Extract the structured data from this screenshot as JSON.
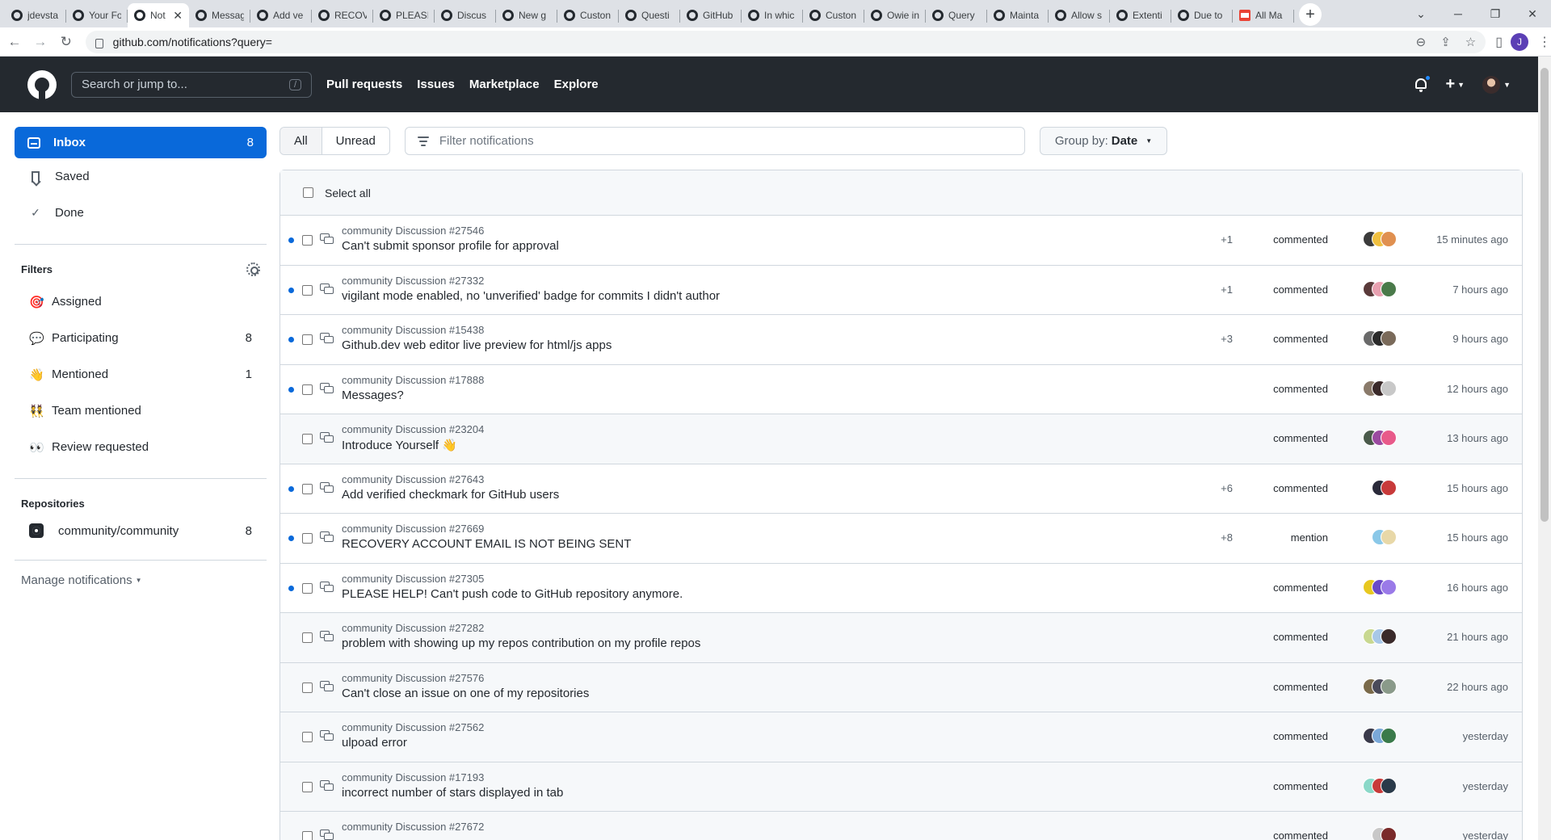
{
  "browser": {
    "tabs": [
      {
        "label": "jdevsta",
        "active": false
      },
      {
        "label": "Your Fo",
        "active": false
      },
      {
        "label": "Not",
        "active": true
      },
      {
        "label": "Messag",
        "active": false
      },
      {
        "label": "Add ve",
        "active": false
      },
      {
        "label": "RECOV",
        "active": false
      },
      {
        "label": "PLEASE",
        "active": false
      },
      {
        "label": "Discus",
        "active": false
      },
      {
        "label": "New g",
        "active": false
      },
      {
        "label": "Custon",
        "active": false
      },
      {
        "label": "Questi",
        "active": false
      },
      {
        "label": "GitHub",
        "active": false
      },
      {
        "label": "In whic",
        "active": false
      },
      {
        "label": "Custon",
        "active": false
      },
      {
        "label": "Owie in",
        "active": false
      },
      {
        "label": "Query",
        "active": false
      },
      {
        "label": "Mainta",
        "active": false
      },
      {
        "label": "Allow s",
        "active": false
      },
      {
        "label": "Extenti",
        "active": false
      },
      {
        "label": "Due to",
        "active": false
      },
      {
        "label": "All Ma",
        "active": false,
        "gmail": true
      }
    ],
    "url": "github.com/notifications?query=",
    "profile_initial": "J"
  },
  "header": {
    "search_placeholder": "Search or jump to...",
    "slash": "/",
    "nav": [
      "Pull requests",
      "Issues",
      "Marketplace",
      "Explore"
    ]
  },
  "sidebar": {
    "inbox": {
      "label": "Inbox",
      "count": "8"
    },
    "saved": "Saved",
    "done": "Done",
    "filters_title": "Filters",
    "filters": [
      {
        "emoji": "🎯",
        "label": "Assigned",
        "count": ""
      },
      {
        "emoji": "💬",
        "label": "Participating",
        "count": "8"
      },
      {
        "emoji": "👋",
        "label": "Mentioned",
        "count": "1"
      },
      {
        "emoji": "👯",
        "label": "Team mentioned",
        "count": ""
      },
      {
        "emoji": "👀",
        "label": "Review requested",
        "count": ""
      }
    ],
    "repos_title": "Repositories",
    "repos": [
      {
        "label": "community/community",
        "count": "8"
      }
    ],
    "manage": "Manage notifications"
  },
  "toolbar": {
    "all": "All",
    "unread": "Unread",
    "filter_placeholder": "Filter notifications",
    "group_by_label": "Group by:",
    "group_by_value": "Date"
  },
  "list": {
    "select_all": "Select all",
    "rows": [
      {
        "meta": "community Discussion #27546",
        "title": "Can't submit sponsor profile for approval",
        "plus": "+1",
        "reason": "commented",
        "time": "15 minutes ago",
        "unread": true,
        "avatars": [
          "#3b3b3b",
          "#f0c040",
          "#e09050"
        ]
      },
      {
        "meta": "community Discussion #27332",
        "title": "vigilant mode enabled, no 'unverified' badge for commits I didn't author",
        "plus": "+1",
        "reason": "commented",
        "time": "7 hours ago",
        "unread": true,
        "avatars": [
          "#5a3a3a",
          "#e8a0b0",
          "#4a7a4a"
        ]
      },
      {
        "meta": "community Discussion #15438",
        "title": "Github.dev web editor live preview for html/js apps",
        "plus": "+3",
        "reason": "commented",
        "time": "9 hours ago",
        "unread": true,
        "avatars": [
          "#6a6a6a",
          "#2a2a2a",
          "#7a6a5a"
        ]
      },
      {
        "meta": "community Discussion #17888",
        "title": "Messages?",
        "plus": "",
        "reason": "commented",
        "time": "12 hours ago",
        "unread": true,
        "avatars": [
          "#8a7a6a",
          "#3a2a2a",
          "#c8c8c8"
        ]
      },
      {
        "meta": "community Discussion #23204",
        "title": "Introduce Yourself 👋",
        "plus": "",
        "reason": "commented",
        "time": "13 hours ago",
        "unread": false,
        "avatars": [
          "#4a5a4a",
          "#9a4aa0",
          "#e85a8a"
        ]
      },
      {
        "meta": "community Discussion #27643",
        "title": "Add verified checkmark for GitHub users",
        "plus": "+6",
        "reason": "commented",
        "time": "15 hours ago",
        "unread": true,
        "avatars": [
          "#2a2a3a",
          "#c83a3a"
        ]
      },
      {
        "meta": "community Discussion #27669",
        "title": "RECOVERY ACCOUNT EMAIL IS NOT BEING SENT",
        "plus": "+8",
        "reason": "mention",
        "time": "15 hours ago",
        "unread": true,
        "avatars": [
          "#8ac8e8",
          "#e8d8a8"
        ]
      },
      {
        "meta": "community Discussion #27305",
        "title": "PLEASE HELP! Can't push code to GitHub repository anymore.",
        "plus": "",
        "reason": "commented",
        "time": "16 hours ago",
        "unread": true,
        "avatars": [
          "#e8c820",
          "#6a4ac8",
          "#9a7ae8"
        ]
      },
      {
        "meta": "community Discussion #27282",
        "title": "problem with showing up my repos contribution on my profile repos",
        "plus": "",
        "reason": "commented",
        "time": "21 hours ago",
        "unread": false,
        "avatars": [
          "#c8d890",
          "#a8c8e8",
          "#3a2a2a"
        ]
      },
      {
        "meta": "community Discussion #27576",
        "title": "Can't close an issue on one of my repositories",
        "plus": "",
        "reason": "commented",
        "time": "22 hours ago",
        "unread": false,
        "avatars": [
          "#7a6a4a",
          "#4a4a5a",
          "#8a9a8a"
        ]
      },
      {
        "meta": "community Discussion #27562",
        "title": "ulpoad error",
        "plus": "",
        "reason": "commented",
        "time": "yesterday",
        "unread": false,
        "avatars": [
          "#3a3a4a",
          "#7aa8d8",
          "#3a7a4a"
        ]
      },
      {
        "meta": "community Discussion #17193",
        "title": "incorrect number of stars displayed in tab",
        "plus": "",
        "reason": "commented",
        "time": "yesterday",
        "unread": false,
        "avatars": [
          "#8ad8c8",
          "#c83a3a",
          "#2a3a4a"
        ]
      },
      {
        "meta": "community Discussion #27672",
        "title": "",
        "plus": "",
        "reason": "commented",
        "time": "yesterday",
        "unread": false,
        "avatars": [
          "#c8c8c8",
          "#7a2a2a"
        ]
      }
    ]
  }
}
